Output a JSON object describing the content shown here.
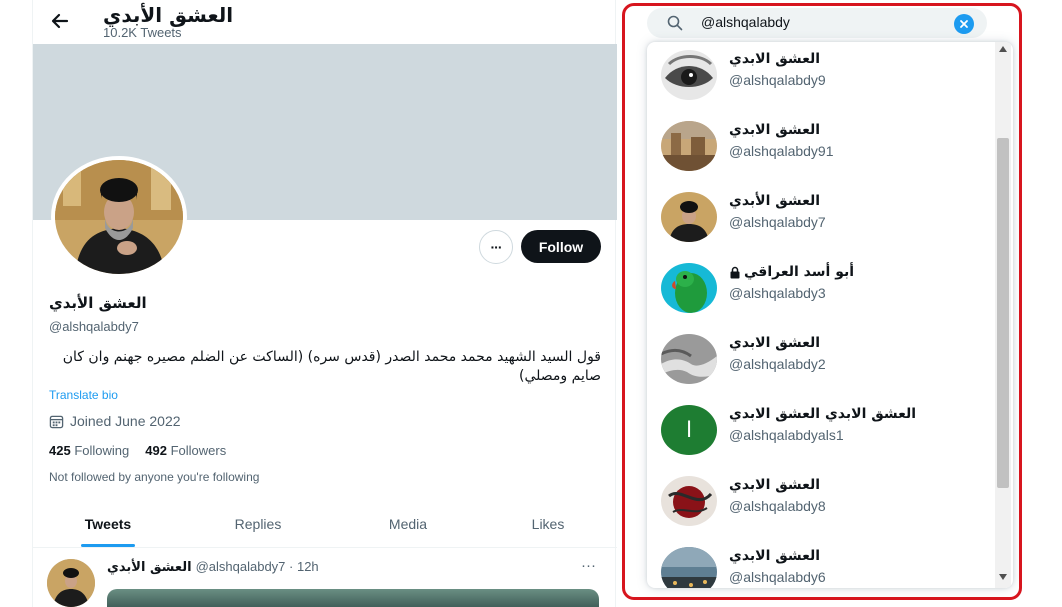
{
  "profile": {
    "top_name": "العشق الأبدي",
    "tweet_count": "10.2K Tweets",
    "display_name": "العشق الأبدي",
    "handle": "@alshqalabdy7",
    "bio": "قول السيد الشهيد محمد محمد الصدر (قدس سره) (الساكت عن الضلم مصيره جهنم وان كان صايم ومصلي)",
    "translate_label": "Translate bio",
    "joined": "Joined June 2022",
    "following_count": "425",
    "following_label": "Following",
    "followers_count": "492",
    "followers_label": "Followers",
    "not_followed_note": "Not followed by anyone you're following",
    "follow_button": "Follow",
    "more_button": "···",
    "tabs": [
      {
        "label": "Tweets"
      },
      {
        "label": "Replies"
      },
      {
        "label": "Media"
      },
      {
        "label": "Likes"
      }
    ],
    "tweet": {
      "name": "العشق الأبدي",
      "handle_time": "@alshqalabdy7 · 12h",
      "more": "···"
    }
  },
  "search": {
    "query": "@alshqalabdy",
    "results": [
      {
        "name": "العشق الابدي",
        "handle": "@alshqalabdy9",
        "avatar": "eye-art",
        "locked": false
      },
      {
        "name": "العشق الابدي",
        "handle": "@alshqalabdy91",
        "avatar": "ruins",
        "locked": false
      },
      {
        "name": "العشق الأبدي",
        "handle": "@alshqalabdy7",
        "avatar": "cleric",
        "locked": false
      },
      {
        "name": "أبو أسد العراقي",
        "handle": "@alshqalabdy3",
        "avatar": "parrot",
        "locked": true
      },
      {
        "name": "العشق الابدي",
        "handle": "@alshqalabdy2",
        "avatar": "hands",
        "locked": false
      },
      {
        "name": "العشق الابدي العشق الابدي",
        "handle": "@alshqalabdyals1",
        "avatar": "green-initial",
        "initial": "ا",
        "locked": false
      },
      {
        "name": "العشق الابدي",
        "handle": "@alshqalabdy8",
        "avatar": "calligraphy",
        "locked": false
      },
      {
        "name": "العشق الابدي",
        "handle": "@alshqalabdy6",
        "avatar": "landscape",
        "locked": false
      }
    ]
  },
  "colors": {
    "accent": "#1d9bf0",
    "highlight_border": "#d7151e",
    "follow_button_bg": "#0f1419"
  }
}
